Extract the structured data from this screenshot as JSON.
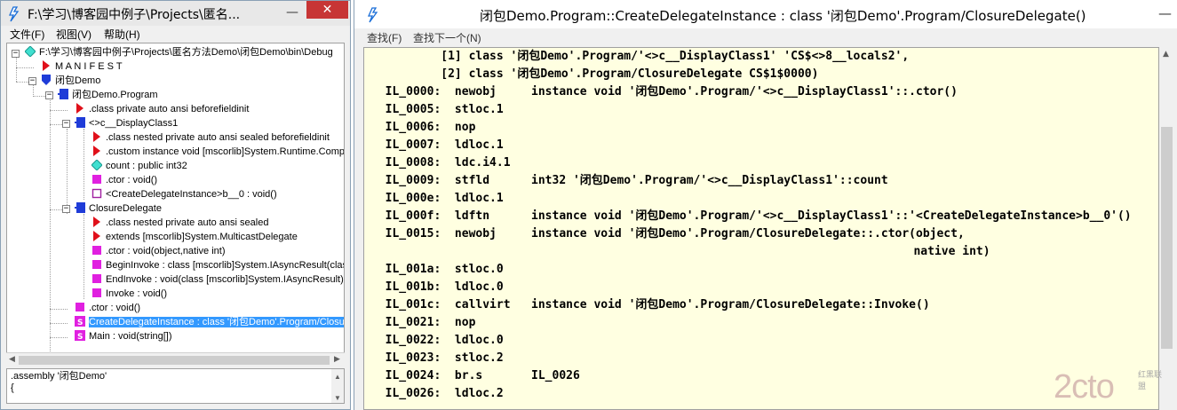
{
  "left_window": {
    "title": "F:\\学习\\博客园中例子\\Projects\\匿名...",
    "close_glyph": "✕",
    "min_glyph": "—",
    "menu": [
      "文件(F)",
      "视图(V)",
      "帮助(H)"
    ],
    "tree": [
      {
        "label": "F:\\学习\\博客园中例子\\Projects\\匿名方法Demo\\闭包Demo\\bin\\Debug",
        "icon": "diamond-cyan-icon"
      },
      {
        "label": "M A N I F E S T",
        "icon": "triangle-red-icon"
      },
      {
        "label": "闭包Demo",
        "icon": "shield-blue-icon"
      },
      {
        "label": "闭包Demo.Program",
        "icon": "class-blue-icon"
      },
      {
        "label": ".class private auto ansi beforefieldinit",
        "icon": "triangle-red-icon"
      },
      {
        "label": "<>c__DisplayClass1",
        "icon": "class-blue-icon"
      },
      {
        "label": ".class nested private auto ansi sealed beforefieldinit",
        "icon": "triangle-red-icon"
      },
      {
        "label": ".custom instance void [mscorlib]System.Runtime.CompilerServices",
        "icon": "triangle-red-icon"
      },
      {
        "label": "count : public int32",
        "icon": "diamond-cyan-icon"
      },
      {
        "label": ".ctor : void()",
        "icon": "method-magenta-icon"
      },
      {
        "label": "<CreateDelegateInstance>b__0 : void()",
        "icon": "method-outline-icon"
      },
      {
        "label": "ClosureDelegate",
        "icon": "class-blue-icon"
      },
      {
        "label": ".class nested private auto ansi sealed",
        "icon": "triangle-red-icon"
      },
      {
        "label": "extends [mscorlib]System.MulticastDelegate",
        "icon": "triangle-red-icon"
      },
      {
        "label": ".ctor : void(object,native int)",
        "icon": "method-magenta-icon"
      },
      {
        "label": "BeginInvoke : class [mscorlib]System.IAsyncResult(class [mscorlib]",
        "icon": "method-magenta-icon"
      },
      {
        "label": "EndInvoke : void(class [mscorlib]System.IAsyncResult)",
        "icon": "method-magenta-icon"
      },
      {
        "label": "Invoke : void()",
        "icon": "method-magenta-icon"
      },
      {
        "label": ".ctor : void()",
        "icon": "method-magenta-icon"
      },
      {
        "label": "CreateDelegateInstance : class '闭包Demo'.Program/ClosureDelegate()",
        "icon": "static-method-icon",
        "selected": true
      },
      {
        "label": "Main : void(string[])",
        "icon": "static-method-icon"
      }
    ],
    "info_pane": [
      ".assembly '闭包Demo'",
      "{"
    ]
  },
  "right_window": {
    "title": "闭包Demo.Program::CreateDelegateInstance : class '闭包Demo'.Program/ClosureDelegate()",
    "min_glyph": "—",
    "menu": [
      "查找(F)",
      "查找下一个(N)"
    ],
    "code_lines": [
      "          [1] class '闭包Demo'.Program/'<>c__DisplayClass1' 'CS$<>8__locals2',",
      "          [2] class '闭包Demo'.Program/ClosureDelegate CS$1$0000)",
      "  IL_0000:  newobj     instance void '闭包Demo'.Program/'<>c__DisplayClass1'::.ctor()",
      "  IL_0005:  stloc.1",
      "  IL_0006:  nop",
      "  IL_0007:  ldloc.1",
      "  IL_0008:  ldc.i4.1",
      "  IL_0009:  stfld      int32 '闭包Demo'.Program/'<>c__DisplayClass1'::count",
      "  IL_000e:  ldloc.1",
      "  IL_000f:  ldftn      instance void '闭包Demo'.Program/'<>c__DisplayClass1'::'<CreateDelegateInstance>b__0'()",
      "  IL_0015:  newobj     instance void '闭包Demo'.Program/ClosureDelegate::.ctor(object,",
      "                                                                              native int)",
      "  IL_001a:  stloc.0",
      "  IL_001b:  ldloc.0",
      "  IL_001c:  callvirt   instance void '闭包Demo'.Program/ClosureDelegate::Invoke()",
      "  IL_0021:  nop",
      "  IL_0022:  ldloc.0",
      "  IL_0023:  stloc.2",
      "  IL_0024:  br.s       IL_0026",
      "  IL_0026:  ldloc.2"
    ],
    "watermark": {
      "main": "2cto",
      "sub": "红黑联盟"
    }
  },
  "colors": {
    "code_bg": "#ffffe1",
    "selection": "#3399ff",
    "close_red": "#c73535"
  }
}
